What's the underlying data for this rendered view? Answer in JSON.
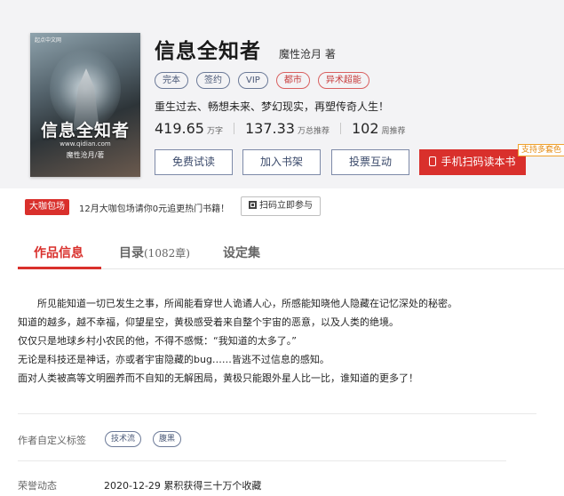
{
  "book": {
    "title": "信息全知者",
    "author": "魔性沧月 著",
    "tags": [
      "完本",
      "签约",
      "VIP",
      "都市",
      "异术超能"
    ],
    "intro": "重生过去、畅想未来、梦幻现实，再塑传奇人生！",
    "cover": {
      "publisher": "起点中文网",
      "title": "信息全知者",
      "url": "www.qidian.com",
      "author": "魔性沧月/著"
    }
  },
  "stats": [
    {
      "value": "419.65",
      "unit": "万字"
    },
    {
      "value": "137.33",
      "unit": "万总推荐"
    },
    {
      "value": "102",
      "unit": "周推荐"
    }
  ],
  "actions": {
    "free_read": "免费试读",
    "add_shelf": "加入书架",
    "vote": "投票互动",
    "phone_read": "手机扫码读本书",
    "multi_color_badge": "支持多套色"
  },
  "promo": {
    "badge": "大咖包场",
    "text": "12月大咖包场请你0元追更热门书籍！",
    "scan_button": "扫码立即参与"
  },
  "tabs": [
    {
      "label": "作品信息",
      "count": ""
    },
    {
      "label": "目录",
      "count": "(1082章)"
    },
    {
      "label": "设定集",
      "count": ""
    }
  ],
  "description": [
    "所见能知道一切已发生之事，所闻能看穿世人诡谲人心，所感能知晓他人隐藏在记忆深处的秘密。",
    "知道的越多，越不幸福，仰望星空，黄极感受着来自整个宇宙的恶意，以及人类的绝境。",
    "仅仅只是地球乡村小农民的他，不得不感慨：“我知道的太多了。”",
    "无论是科技还是神话，亦或者宇宙隐藏的bug……皆逃不过信息的感知。",
    "面对人类被高等文明圈养而不自知的无解困局，黄极只能跟外星人比一比，谁知道的更多了！"
  ],
  "custom_tags": {
    "label": "作者自定义标签",
    "tags": [
      "技术流",
      "腹黑"
    ]
  },
  "honor": {
    "label": "荣誉动态",
    "text": "2020-12-29 累积获得三十万个收藏"
  },
  "colors": {
    "accent": "#d9302c",
    "tag_border": "#6c7a98",
    "badge_orange": "#f0a22c"
  }
}
